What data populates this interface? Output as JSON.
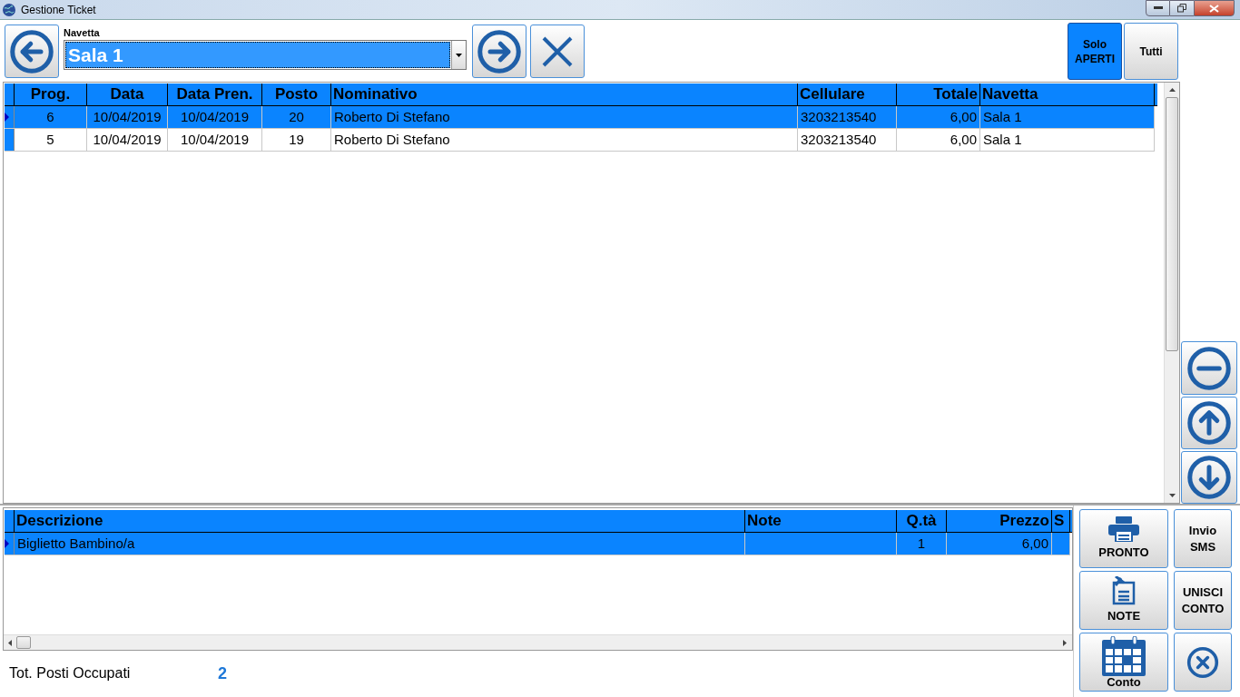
{
  "window": {
    "title": "Gestione Ticket"
  },
  "navetta": {
    "label": "Navetta",
    "value": "Sala 1"
  },
  "filters": [
    {
      "label": "Solo APERTI",
      "selected": true
    },
    {
      "label": "Tutti",
      "selected": false
    }
  ],
  "tickets": {
    "columns": [
      "Prog.",
      "Data",
      "Data Pren.",
      "Posto",
      "Nominativo",
      "Cellulare",
      "Totale",
      "Navetta"
    ],
    "rows": [
      {
        "selected": true,
        "cells": [
          "6",
          "10/04/2019",
          "10/04/2019",
          "20",
          "Roberto Di Stefano",
          "3203213540",
          "6,00",
          "Sala 1"
        ]
      },
      {
        "selected": false,
        "cells": [
          "5",
          "10/04/2019",
          "10/04/2019",
          "19",
          "Roberto Di Stefano",
          "3203213540",
          "6,00",
          "Sala 1"
        ]
      }
    ]
  },
  "details": {
    "columns": [
      "Descrizione",
      "Note",
      "Q.tà",
      "Prezzo",
      "S"
    ],
    "rows": [
      {
        "selected": true,
        "cells": [
          "Biglietto Bambino/a",
          null,
          "1",
          "6,00",
          null
        ]
      }
    ]
  },
  "footer": {
    "label": "Tot. Posti Occupati",
    "value": "2"
  },
  "actions": {
    "pronto": "PRONTO",
    "invio_sms": "Invio SMS",
    "note": "NOTE",
    "unisci_conto": "UNISCI CONTO",
    "conto": "Conto"
  }
}
